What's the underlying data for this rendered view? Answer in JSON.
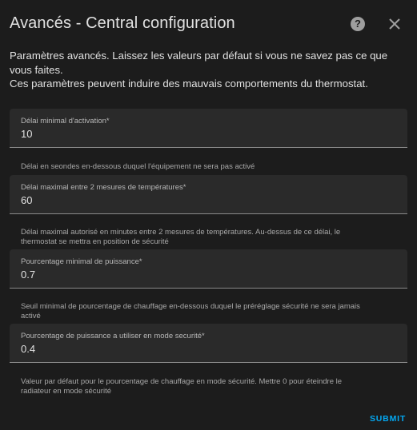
{
  "dialog": {
    "title": "Avancés - Central configuration",
    "help_icon": "help-circle-icon",
    "help_glyph": "?",
    "close_icon": "close-icon"
  },
  "intro": {
    "line1": "Paramètres avancés. Laissez les valeurs par défaut si vous ne savez pas ce que vous faites.",
    "line2": "Ces paramètres peuvent induire des mauvais comportements du thermostat."
  },
  "fields": [
    {
      "label": "Délai minimal d'activation*",
      "value": "10",
      "helper": "Délai en seondes en-dessous duquel l'équipement ne sera pas activé"
    },
    {
      "label": "Délai maximal entre 2 mesures de températures*",
      "value": "60",
      "helper": "Délai maximal autorisé en minutes entre 2 mesures de températures. Au-dessus de ce délai, le thermostat se mettra en position de sécurité"
    },
    {
      "label": "Pourcentage minimal de puissance*",
      "value": "0.7",
      "helper": "Seuil minimal de pourcentage de chauffage en-dessous duquel le préréglage sécurité ne sera jamais activé"
    },
    {
      "label": "Pourcentage de puissance a utiliser en mode securité*",
      "value": "0.4",
      "helper": "Valeur par défaut pour le pourcentage de chauffage en mode sécurité. Mettre 0 pour éteindre le radiateur en mode sécurité"
    }
  ],
  "actions": {
    "submit_label": "SUBMIT"
  },
  "colors": {
    "background": "#1c1c1c",
    "field_background": "#2a2a2a",
    "accent": "#03a9f4"
  }
}
